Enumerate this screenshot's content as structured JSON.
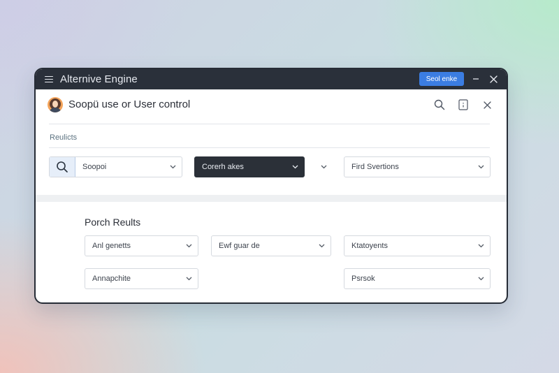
{
  "window": {
    "title": "Alternive Engine",
    "action_button": "Seol enke"
  },
  "header": {
    "title": "Soopü use or User control"
  },
  "filters": {
    "label": "Reulicts",
    "search_value": "Soopoi",
    "dark_select": "Corerh akes",
    "right_select": "Fird Svertions"
  },
  "results": {
    "title": "Porch Reults",
    "selects": [
      "Anl genetts",
      "Ewf guar de",
      "Ktatoyents",
      "Annapchite",
      "Psrsok"
    ]
  },
  "icons": {
    "menu": "hamburger-icon",
    "minimize": "minimize-icon",
    "close": "close-icon",
    "search": "search-icon",
    "document": "document-icon",
    "chevron": "chevron-down-icon"
  },
  "colors": {
    "titlebar": "#2a303a",
    "accent": "#3b7de2",
    "dark_select": "#2b3038",
    "search_button_bg": "#e6eef9"
  }
}
